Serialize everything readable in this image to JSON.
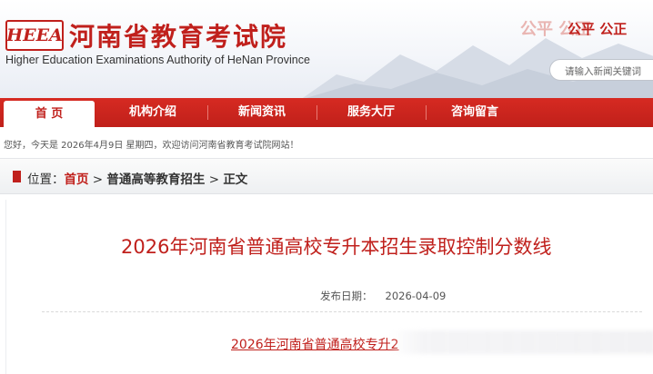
{
  "header": {
    "logo_text": "HEEA",
    "site_title": "河南省教育考试院",
    "site_subtitle": "Higher Education Examinations Authority of HeNan Province",
    "slogan_faded": "公平 公正",
    "slogan": "公平 公正",
    "search_placeholder": "请输入新闻关键词"
  },
  "nav": {
    "items": [
      {
        "label": "首 页",
        "active": true
      },
      {
        "label": "机构介绍",
        "active": false
      },
      {
        "label": "新闻资讯",
        "active": false
      },
      {
        "label": "服务大厅",
        "active": false
      },
      {
        "label": "咨询留言",
        "active": false
      }
    ]
  },
  "welcome": "您好，今天是 2026年4月9日 星期四，欢迎访问河南省教育考试院网站！",
  "breadcrumb": {
    "prefix": "位置：",
    "home": "首页",
    "sep1": " > ",
    "category": "普通高等教育招生",
    "sep2": " > ",
    "current": "正文"
  },
  "article": {
    "title": "2026年河南省普通高校专升本招生录取控制分数线",
    "pub_label": "发布日期：",
    "pub_date": "2026-04-09",
    "link_text": "2026年河南省普通高校专升2"
  },
  "colors": {
    "brand_red": "#c0201c",
    "nav_red": "#d62a22"
  }
}
